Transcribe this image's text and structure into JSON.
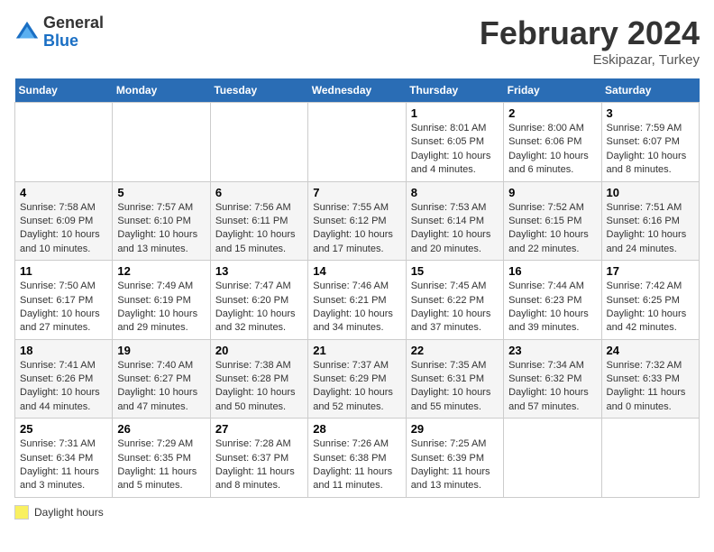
{
  "logo": {
    "general": "General",
    "blue": "Blue"
  },
  "header": {
    "month_year": "February 2024",
    "location": "Eskipazar, Turkey"
  },
  "days_of_week": [
    "Sunday",
    "Monday",
    "Tuesday",
    "Wednesday",
    "Thursday",
    "Friday",
    "Saturday"
  ],
  "legend": {
    "label": "Daylight hours"
  },
  "weeks": [
    [
      {
        "day": "",
        "info": ""
      },
      {
        "day": "",
        "info": ""
      },
      {
        "day": "",
        "info": ""
      },
      {
        "day": "",
        "info": ""
      },
      {
        "day": "1",
        "info": "Sunrise: 8:01 AM\nSunset: 6:05 PM\nDaylight: 10 hours\nand 4 minutes."
      },
      {
        "day": "2",
        "info": "Sunrise: 8:00 AM\nSunset: 6:06 PM\nDaylight: 10 hours\nand 6 minutes."
      },
      {
        "day": "3",
        "info": "Sunrise: 7:59 AM\nSunset: 6:07 PM\nDaylight: 10 hours\nand 8 minutes."
      }
    ],
    [
      {
        "day": "4",
        "info": "Sunrise: 7:58 AM\nSunset: 6:09 PM\nDaylight: 10 hours\nand 10 minutes."
      },
      {
        "day": "5",
        "info": "Sunrise: 7:57 AM\nSunset: 6:10 PM\nDaylight: 10 hours\nand 13 minutes."
      },
      {
        "day": "6",
        "info": "Sunrise: 7:56 AM\nSunset: 6:11 PM\nDaylight: 10 hours\nand 15 minutes."
      },
      {
        "day": "7",
        "info": "Sunrise: 7:55 AM\nSunset: 6:12 PM\nDaylight: 10 hours\nand 17 minutes."
      },
      {
        "day": "8",
        "info": "Sunrise: 7:53 AM\nSunset: 6:14 PM\nDaylight: 10 hours\nand 20 minutes."
      },
      {
        "day": "9",
        "info": "Sunrise: 7:52 AM\nSunset: 6:15 PM\nDaylight: 10 hours\nand 22 minutes."
      },
      {
        "day": "10",
        "info": "Sunrise: 7:51 AM\nSunset: 6:16 PM\nDaylight: 10 hours\nand 24 minutes."
      }
    ],
    [
      {
        "day": "11",
        "info": "Sunrise: 7:50 AM\nSunset: 6:17 PM\nDaylight: 10 hours\nand 27 minutes."
      },
      {
        "day": "12",
        "info": "Sunrise: 7:49 AM\nSunset: 6:19 PM\nDaylight: 10 hours\nand 29 minutes."
      },
      {
        "day": "13",
        "info": "Sunrise: 7:47 AM\nSunset: 6:20 PM\nDaylight: 10 hours\nand 32 minutes."
      },
      {
        "day": "14",
        "info": "Sunrise: 7:46 AM\nSunset: 6:21 PM\nDaylight: 10 hours\nand 34 minutes."
      },
      {
        "day": "15",
        "info": "Sunrise: 7:45 AM\nSunset: 6:22 PM\nDaylight: 10 hours\nand 37 minutes."
      },
      {
        "day": "16",
        "info": "Sunrise: 7:44 AM\nSunset: 6:23 PM\nDaylight: 10 hours\nand 39 minutes."
      },
      {
        "day": "17",
        "info": "Sunrise: 7:42 AM\nSunset: 6:25 PM\nDaylight: 10 hours\nand 42 minutes."
      }
    ],
    [
      {
        "day": "18",
        "info": "Sunrise: 7:41 AM\nSunset: 6:26 PM\nDaylight: 10 hours\nand 44 minutes."
      },
      {
        "day": "19",
        "info": "Sunrise: 7:40 AM\nSunset: 6:27 PM\nDaylight: 10 hours\nand 47 minutes."
      },
      {
        "day": "20",
        "info": "Sunrise: 7:38 AM\nSunset: 6:28 PM\nDaylight: 10 hours\nand 50 minutes."
      },
      {
        "day": "21",
        "info": "Sunrise: 7:37 AM\nSunset: 6:29 PM\nDaylight: 10 hours\nand 52 minutes."
      },
      {
        "day": "22",
        "info": "Sunrise: 7:35 AM\nSunset: 6:31 PM\nDaylight: 10 hours\nand 55 minutes."
      },
      {
        "day": "23",
        "info": "Sunrise: 7:34 AM\nSunset: 6:32 PM\nDaylight: 10 hours\nand 57 minutes."
      },
      {
        "day": "24",
        "info": "Sunrise: 7:32 AM\nSunset: 6:33 PM\nDaylight: 11 hours\nand 0 minutes."
      }
    ],
    [
      {
        "day": "25",
        "info": "Sunrise: 7:31 AM\nSunset: 6:34 PM\nDaylight: 11 hours\nand 3 minutes."
      },
      {
        "day": "26",
        "info": "Sunrise: 7:29 AM\nSunset: 6:35 PM\nDaylight: 11 hours\nand 5 minutes."
      },
      {
        "day": "27",
        "info": "Sunrise: 7:28 AM\nSunset: 6:37 PM\nDaylight: 11 hours\nand 8 minutes."
      },
      {
        "day": "28",
        "info": "Sunrise: 7:26 AM\nSunset: 6:38 PM\nDaylight: 11 hours\nand 11 minutes."
      },
      {
        "day": "29",
        "info": "Sunrise: 7:25 AM\nSunset: 6:39 PM\nDaylight: 11 hours\nand 13 minutes."
      },
      {
        "day": "",
        "info": ""
      },
      {
        "day": "",
        "info": ""
      }
    ]
  ]
}
